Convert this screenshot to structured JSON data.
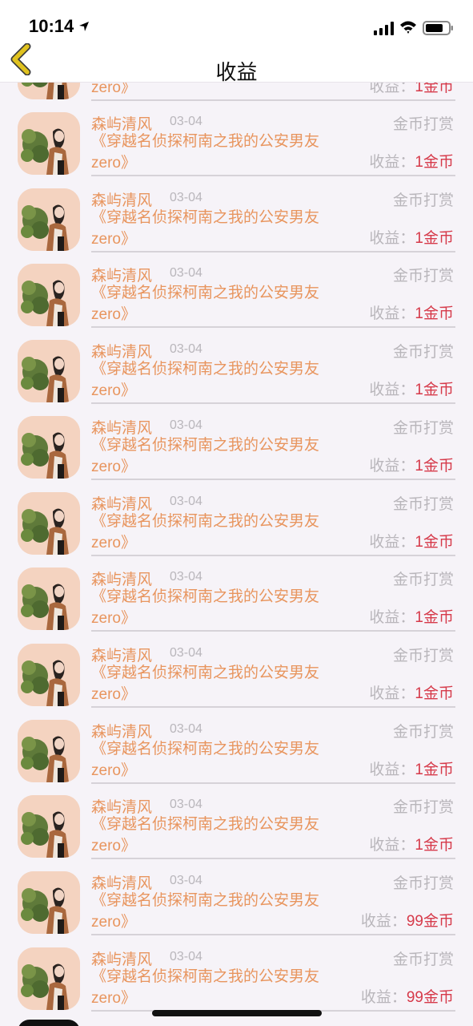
{
  "status_bar": {
    "time": "10:14"
  },
  "nav": {
    "title": "收益"
  },
  "top_row": {
    "book_line2": "zero》",
    "earn_label": "收益：",
    "earn_value": "1金币"
  },
  "rows": [
    {
      "name": "森屿清风",
      "date": "03-04",
      "type": "金币打赏",
      "book_line1": "《穿越名侦探柯南之我的公安男友",
      "book_line2": "zero》",
      "earn_label": "收益：",
      "earn_value": "1金币"
    },
    {
      "name": "森屿清风",
      "date": "03-04",
      "type": "金币打赏",
      "book_line1": "《穿越名侦探柯南之我的公安男友",
      "book_line2": "zero》",
      "earn_label": "收益：",
      "earn_value": "1金币"
    },
    {
      "name": "森屿清风",
      "date": "03-04",
      "type": "金币打赏",
      "book_line1": "《穿越名侦探柯南之我的公安男友",
      "book_line2": "zero》",
      "earn_label": "收益：",
      "earn_value": "1金币"
    },
    {
      "name": "森屿清风",
      "date": "03-04",
      "type": "金币打赏",
      "book_line1": "《穿越名侦探柯南之我的公安男友",
      "book_line2": "zero》",
      "earn_label": "收益：",
      "earn_value": "1金币"
    },
    {
      "name": "森屿清风",
      "date": "03-04",
      "type": "金币打赏",
      "book_line1": "《穿越名侦探柯南之我的公安男友",
      "book_line2": "zero》",
      "earn_label": "收益：",
      "earn_value": "1金币"
    },
    {
      "name": "森屿清风",
      "date": "03-04",
      "type": "金币打赏",
      "book_line1": "《穿越名侦探柯南之我的公安男友",
      "book_line2": "zero》",
      "earn_label": "收益：",
      "earn_value": "1金币"
    },
    {
      "name": "森屿清风",
      "date": "03-04",
      "type": "金币打赏",
      "book_line1": "《穿越名侦探柯南之我的公安男友",
      "book_line2": "zero》",
      "earn_label": "收益：",
      "earn_value": "1金币"
    },
    {
      "name": "森屿清风",
      "date": "03-04",
      "type": "金币打赏",
      "book_line1": "《穿越名侦探柯南之我的公安男友",
      "book_line2": "zero》",
      "earn_label": "收益：",
      "earn_value": "1金币"
    },
    {
      "name": "森屿清风",
      "date": "03-04",
      "type": "金币打赏",
      "book_line1": "《穿越名侦探柯南之我的公安男友",
      "book_line2": "zero》",
      "earn_label": "收益：",
      "earn_value": "1金币"
    },
    {
      "name": "森屿清风",
      "date": "03-04",
      "type": "金币打赏",
      "book_line1": "《穿越名侦探柯南之我的公安男友",
      "book_line2": "zero》",
      "earn_label": "收益：",
      "earn_value": "1金币"
    },
    {
      "name": "森屿清风",
      "date": "03-04",
      "type": "金币打赏",
      "book_line1": "《穿越名侦探柯南之我的公安男友",
      "book_line2": "zero》",
      "earn_label": "收益：",
      "earn_value": "99金币"
    },
    {
      "name": "森屿清风",
      "date": "03-04",
      "type": "金币打赏",
      "book_line1": "《穿越名侦探柯南之我的公安男友",
      "book_line2": "zero》",
      "earn_label": "收益：",
      "earn_value": "99金币"
    }
  ],
  "colors": {
    "accent_orange": "#e8955e",
    "earn_red": "#d63a4a",
    "muted_gray": "#b9b6bb",
    "back_chevron": "#e0c21f",
    "background": "#f6f3f8"
  }
}
